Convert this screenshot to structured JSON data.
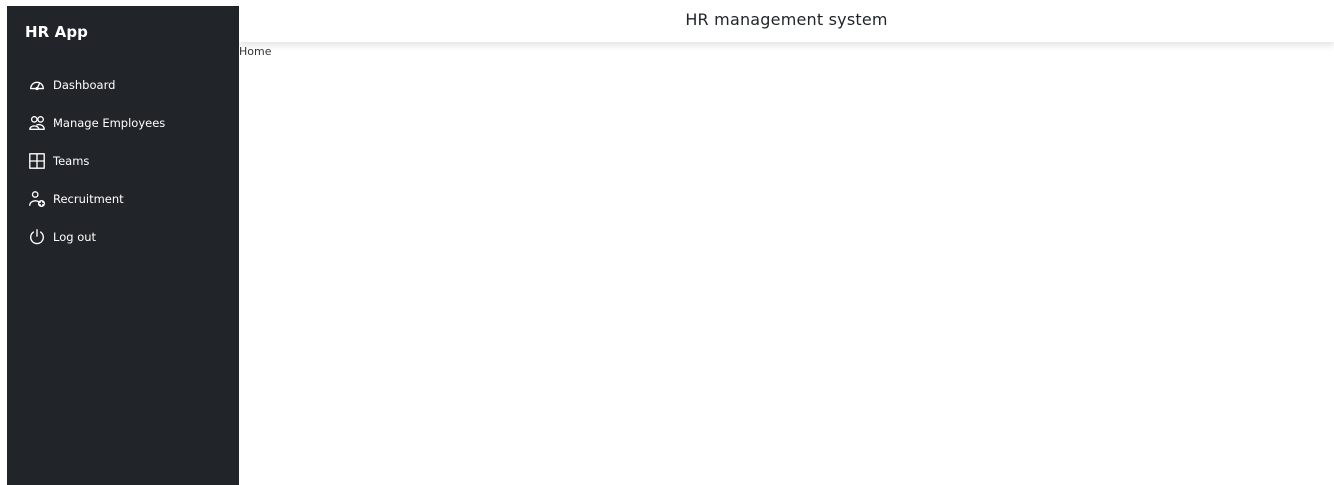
{
  "sidebar": {
    "brand": "HR App",
    "items": [
      {
        "label": "Dashboard",
        "icon": "dashboard-gauge-icon"
      },
      {
        "label": "Manage Employees",
        "icon": "people-icon"
      },
      {
        "label": "Teams",
        "icon": "layout-grid-icon"
      },
      {
        "label": "Recruitment",
        "icon": "person-add-icon"
      },
      {
        "label": "Log out",
        "icon": "power-icon"
      }
    ]
  },
  "header": {
    "title": "HR management system"
  },
  "breadcrumb": {
    "current": "Home"
  },
  "colors": {
    "sidebar_bg": "#212529",
    "text_light": "#ffffff",
    "page_bg": "#ffffff"
  }
}
